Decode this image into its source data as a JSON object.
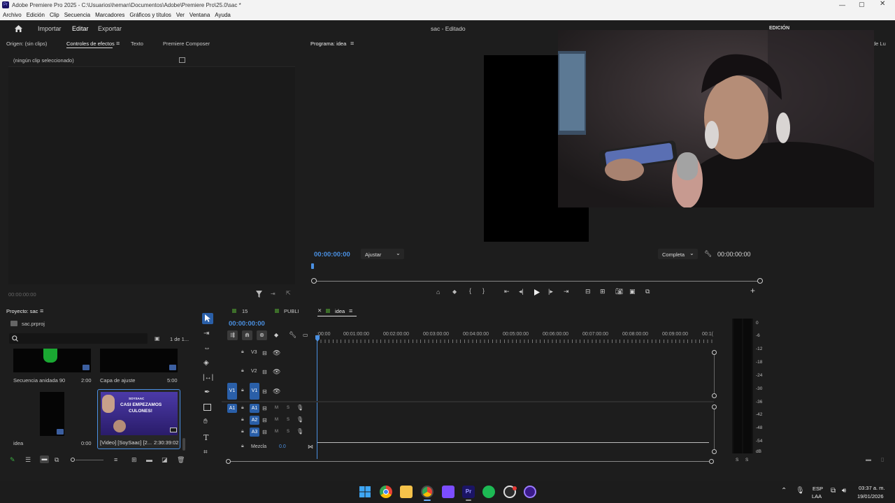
{
  "window": {
    "title": "Adobe Premiere Pro 2025 - C:\\Usuarios\\heman\\Documentos\\Adobe\\Premiere Pro\\25.0\\sac *"
  },
  "menu": [
    "Archivo",
    "Edición",
    "Clip",
    "Secuencia",
    "Marcadores",
    "Gráficos y títulos",
    "Ver",
    "Ventana",
    "Ayuda"
  ],
  "header": {
    "importar": "Importar",
    "editar": "Editar",
    "exportar": "Exportar",
    "project_title": "sac - Editado",
    "workspace": "EDICIÓN",
    "right_cut": "de Lu"
  },
  "source_panel": {
    "tabs": [
      "Origen: (sin clips)",
      "Controles de efectos",
      "Texto",
      "Premiere Composer"
    ],
    "no_clip": "(ningún clip seleccionado)",
    "timecode": "00:00:00:00"
  },
  "program_panel": {
    "tab": "Programa: idea",
    "timecode_left": "00:00:00:00",
    "fit": "Ajustar",
    "quality": "Completa",
    "timecode_right": "00:00:00:00"
  },
  "project_panel": {
    "tab": "Proyecto: sac",
    "file": "sac.prproj",
    "count": "1 de 1...",
    "search_placeholder": "",
    "items": [
      {
        "name": "Secuencia anidada 90",
        "duration": "2:00"
      },
      {
        "name": "Capa de ajuste",
        "duration": "5:00"
      },
      {
        "name": "idea",
        "duration": "0:00"
      },
      {
        "name": "[Video] [SoySaac] [2...",
        "duration": "2:30:39:02"
      }
    ],
    "thumb_text": [
      "SOYSAAC",
      "CASI EMPEZAMOS",
      "CULONES!"
    ]
  },
  "timeline": {
    "tabs": [
      "15",
      "PUBLI",
      "idea"
    ],
    "timecode": "00:00:00:00",
    "ruler": [
      ":00:00",
      "00:01:00:00",
      "00:02:00:00",
      "00:03:00:00",
      "00:04:00:00",
      "00:05:00:00",
      "00:06:00:00",
      "00:07:00:00",
      "00:08:00:00",
      "00:09:00:00",
      "00:1("
    ],
    "video_tracks": [
      "V3",
      "V2",
      "V1"
    ],
    "audio_tracks": [
      "A1",
      "A2",
      "A3"
    ],
    "src_v": "V1",
    "src_a": "A1",
    "m": "M",
    "s": "S",
    "mix_label": "Mezcla",
    "mix_value": "0.0"
  },
  "meter": {
    "scale": [
      "0",
      "-6",
      "-12",
      "-18",
      "-24",
      "-30",
      "-36",
      "-42",
      "-48",
      "-54",
      "dB"
    ],
    "bottom": [
      "S",
      "S"
    ]
  },
  "taskbar": {
    "lang1": "ESP",
    "lang2": "LAA",
    "time": "03:37 a. m.",
    "date": "19/01/2026"
  },
  "colors": {
    "accent": "#4a90e2",
    "track_blue": "#2a5fa8",
    "panel": "#1d1d1d",
    "bg": "#111111"
  }
}
